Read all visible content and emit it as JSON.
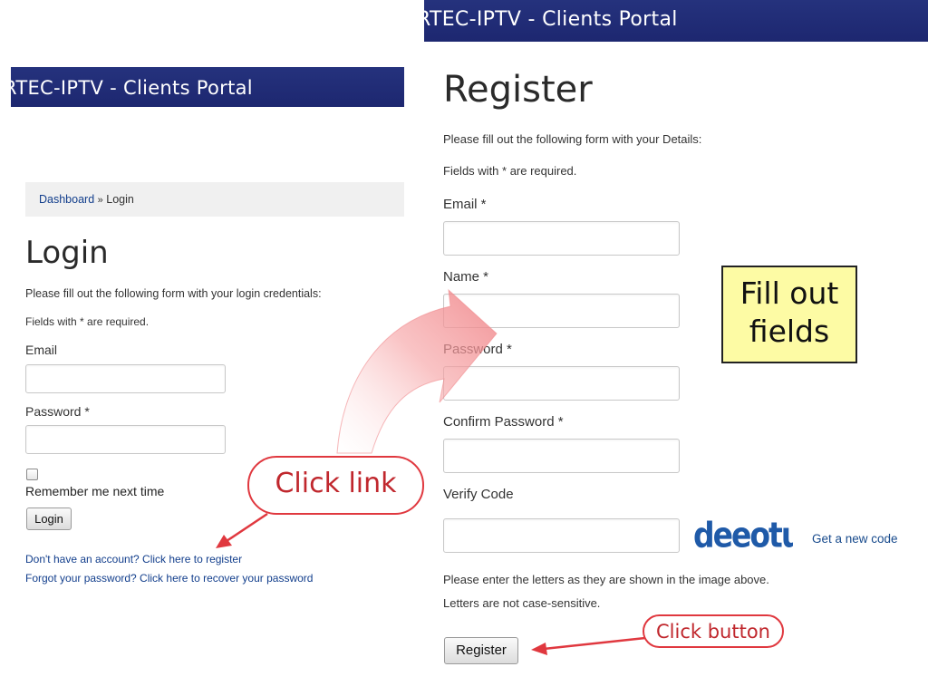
{
  "login_panel": {
    "banner_title": "RTEC-IPTV - Clients Portal",
    "breadcrumb": {
      "home": "Dashboard",
      "separator": "»",
      "current": "Login"
    },
    "title": "Login",
    "intro": "Please fill out the following form with your login credentials:",
    "required_note": "Fields with * are required.",
    "email_label": "Email",
    "password_label": "Password *",
    "remember_label": "Remember me next time",
    "login_button": "Login",
    "register_link": "Don't have an account? Click here to register",
    "recover_link": "Forgot your password? Click here to recover your password"
  },
  "register_panel": {
    "banner_title": "RTEC-IPTV - Clients Portal",
    "title": "Register",
    "intro": "Please fill out the following form with your Details:",
    "required_note": "Fields with * are required.",
    "email_label": "Email *",
    "name_label": "Name *",
    "password_label": "Password *",
    "confirm_label": "Confirm Password *",
    "verify_label": "Verify Code",
    "captcha_text": "deeotu",
    "new_code_link": "Get a new code",
    "hint_line1": "Please enter the letters as they are shown in the image above.",
    "hint_line2": "Letters are not case-sensitive.",
    "register_button": "Register"
  },
  "annotations": {
    "click_link": "Click link",
    "fill_out_line1": "Fill out",
    "fill_out_line2": "fields",
    "click_button": "Click button",
    "accent_color": "#e0383f",
    "note_color": "#fdfba4"
  }
}
